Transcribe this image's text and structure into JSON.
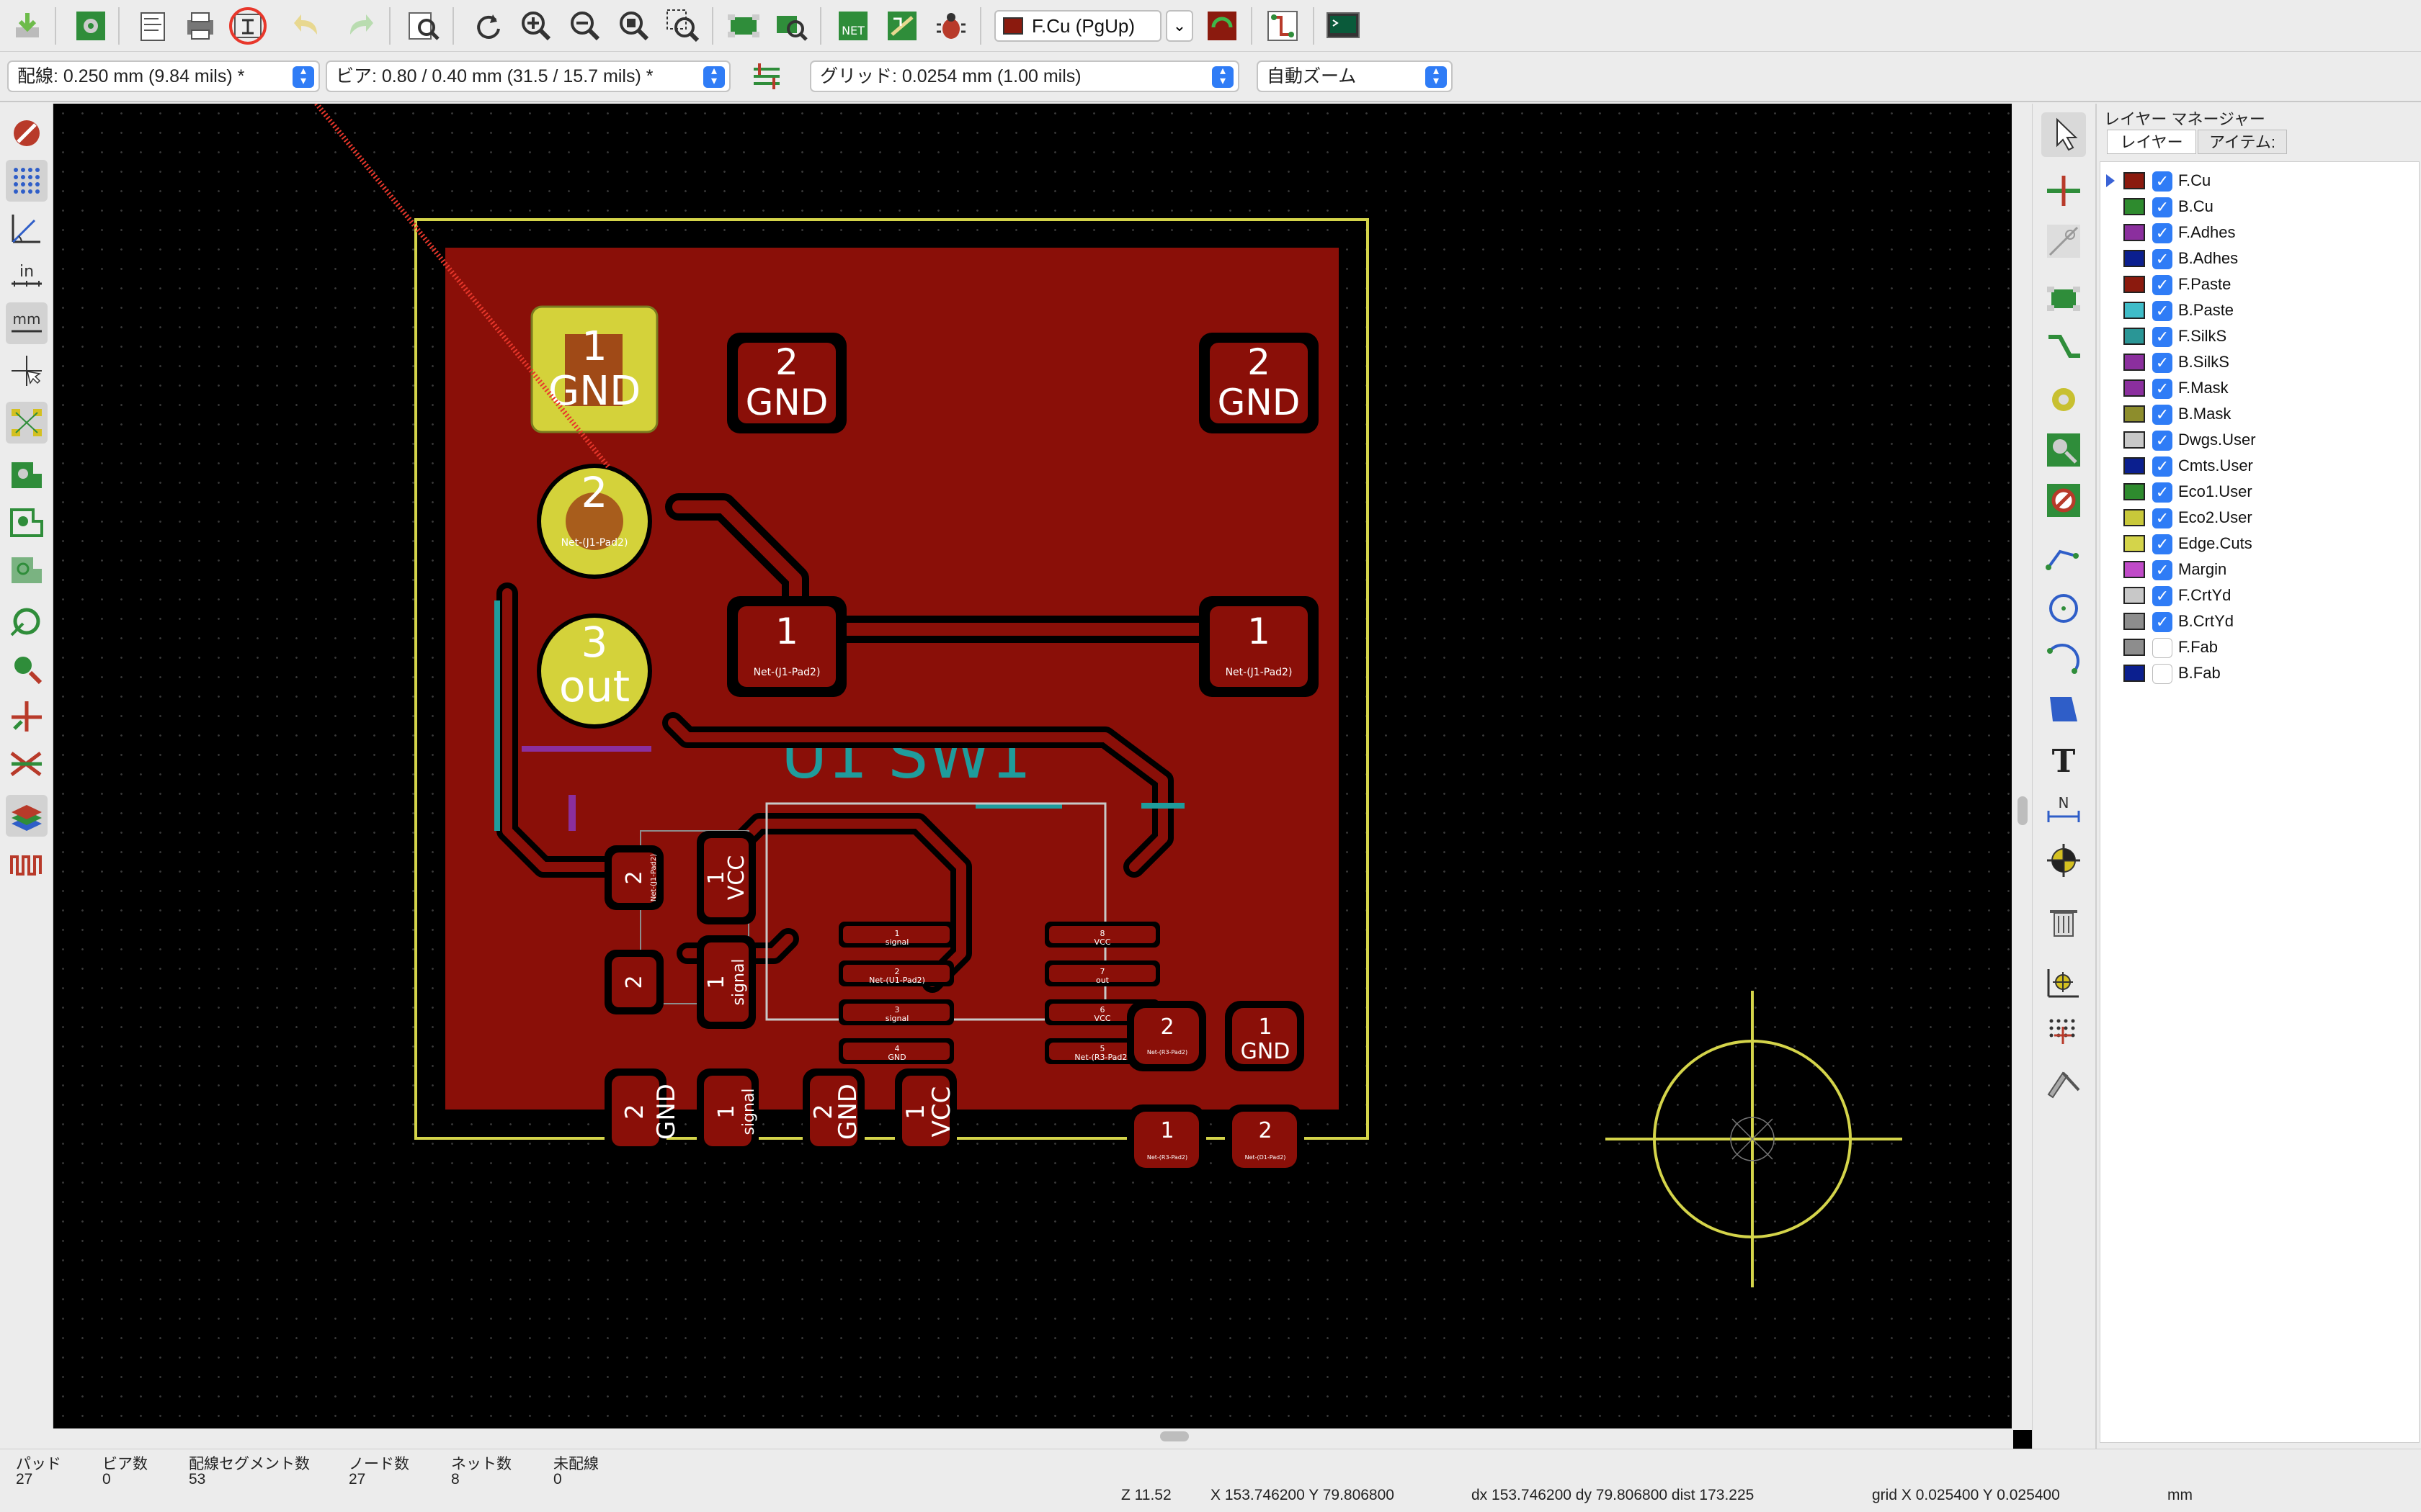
{
  "toolbar": {
    "active_layer": "F.Cu (PgUp)",
    "icons": [
      "save-icon",
      "board-setup-icon",
      "page-settings-icon",
      "print-icon",
      "plot-icon",
      "undo-icon",
      "redo-icon",
      "find-icon",
      "redraw-icon",
      "zoom-in-icon",
      "zoom-out-icon",
      "zoom-fit-icon",
      "zoom-selection-icon",
      "footprint-editor-icon",
      "footprint-browser-icon",
      "netlist-icon",
      "update-pcb-icon",
      "drc-icon",
      "layer-swatch-icon",
      "layer-pair-icon",
      "microwave-icon",
      "scripting-console-icon"
    ]
  },
  "options_bar": {
    "track_width": "配線: 0.250 mm (9.84 mils) *",
    "via_size": "ビア: 0.80 / 0.40 mm (31.5 / 15.7 mils) *",
    "grid": "グリッド: 0.0254 mm (1.00 mils)",
    "zoom": "自動ズーム"
  },
  "layer_manager": {
    "title": "レイヤー マネージャー",
    "tabs": [
      "レイヤー",
      "アイテム:"
    ],
    "layers": [
      {
        "name": "F.Cu",
        "color": "#8b1a0e",
        "visible": true,
        "selected": true
      },
      {
        "name": "B.Cu",
        "color": "#2e8b2e",
        "visible": true
      },
      {
        "name": "F.Adhes",
        "color": "#8b2f9e",
        "visible": true
      },
      {
        "name": "B.Adhes",
        "color": "#0b1f8f",
        "visible": true
      },
      {
        "name": "F.Paste",
        "color": "#8b1a0e",
        "visible": true
      },
      {
        "name": "B.Paste",
        "color": "#3fbcc8",
        "visible": true
      },
      {
        "name": "F.SilkS",
        "color": "#2a9696",
        "visible": true
      },
      {
        "name": "B.SilkS",
        "color": "#8b2f9e",
        "visible": true
      },
      {
        "name": "F.Mask",
        "color": "#8b2f9e",
        "visible": true
      },
      {
        "name": "B.Mask",
        "color": "#8d8d2c",
        "visible": true
      },
      {
        "name": "Dwgs.User",
        "color": "#c8c8c8",
        "visible": true
      },
      {
        "name": "Cmts.User",
        "color": "#0b1f8f",
        "visible": true
      },
      {
        "name": "Eco1.User",
        "color": "#2e8b2e",
        "visible": true
      },
      {
        "name": "Eco2.User",
        "color": "#c8c83a",
        "visible": true
      },
      {
        "name": "Edge.Cuts",
        "color": "#d4d44a",
        "visible": true
      },
      {
        "name": "Margin",
        "color": "#c04ac8",
        "visible": true
      },
      {
        "name": "F.CrtYd",
        "color": "#c8c8c8",
        "visible": true
      },
      {
        "name": "B.CrtYd",
        "color": "#8d8d8d",
        "visible": true
      },
      {
        "name": "F.Fab",
        "color": "#8d8d8d",
        "visible": false
      },
      {
        "name": "B.Fab",
        "color": "#0b1f8f",
        "visible": false
      }
    ]
  },
  "board": {
    "pads": {
      "j1_1_num": "1",
      "j1_1_net": "GND",
      "j1_2_num": "2",
      "j1_2_net": "Net-(J1-Pad2)",
      "j1_3_num": "3",
      "j1_3_net": "out",
      "sw_tl_num": "2",
      "sw_tl_net": "GND",
      "sw_tr_num": "2",
      "sw_tr_net": "GND",
      "sw_bl_num": "1",
      "sw_bl_net": "Net-(J1-Pad2)",
      "sw_br_num": "1",
      "sw_br_net": "Net-(J1-Pad2)",
      "r_a2": "2",
      "r_a1": "1",
      "r_a1_net": "VCC",
      "r_b2": "2",
      "r_b1": "1",
      "r_b1_net": "signal",
      "r_c2": "2",
      "r_c2_net": "GND",
      "r_c1": "1",
      "r_c1_net": "signal",
      "r_d2": "2",
      "r_d2_net": "GND",
      "r_d1": "1",
      "r_d1_net": "VCC",
      "u1_p1": "1",
      "u1_p1_net": "signal",
      "u1_p2": "2",
      "u1_p2_net": "Net-(U1-Pad2)",
      "u1_p3": "3",
      "u1_p3_net": "signal",
      "u1_p4": "4",
      "u1_p4_net": "GND",
      "u1_p5": "5",
      "u1_p5_net": "Net-(R3-Pad2)",
      "u1_p6": "6",
      "u1_p6_net": "VCC",
      "u1_p7": "7",
      "u1_p7_net": "out",
      "u1_p8": "8",
      "u1_p8_net": "VCC",
      "r3_2": "2",
      "r3_2_net": "Net-(R3-Pad2)",
      "gnd_1": "1",
      "gnd_1_net": "GND",
      "bot_1": "1",
      "bot_1_net": "Net-(R3-Pad2)",
      "bot_2": "2",
      "bot_2_net": "Net-(D1-Pad2)",
      "rot_a_net": "Net-(J1-Pad2)",
      "rot_b_net": "Net-(U1-Pad2)"
    },
    "silk_text": "U1   SW1"
  },
  "status": {
    "pads_label": "パッド",
    "pads": "27",
    "vias_label": "ビア数",
    "vias": "0",
    "segments_label": "配線セグメント数",
    "segments": "53",
    "nodes_label": "ノード数",
    "nodes": "27",
    "nets_label": "ネット数",
    "nets": "8",
    "unrouted_label": "未配線",
    "unrouted": "0",
    "zoom": "Z 11.52",
    "xy": "X 153.746200  Y 79.806800",
    "delta": "dx 153.746200  dy 79.806800  dist 173.225",
    "grid": "grid X 0.025400  Y 0.025400",
    "units": "mm"
  }
}
